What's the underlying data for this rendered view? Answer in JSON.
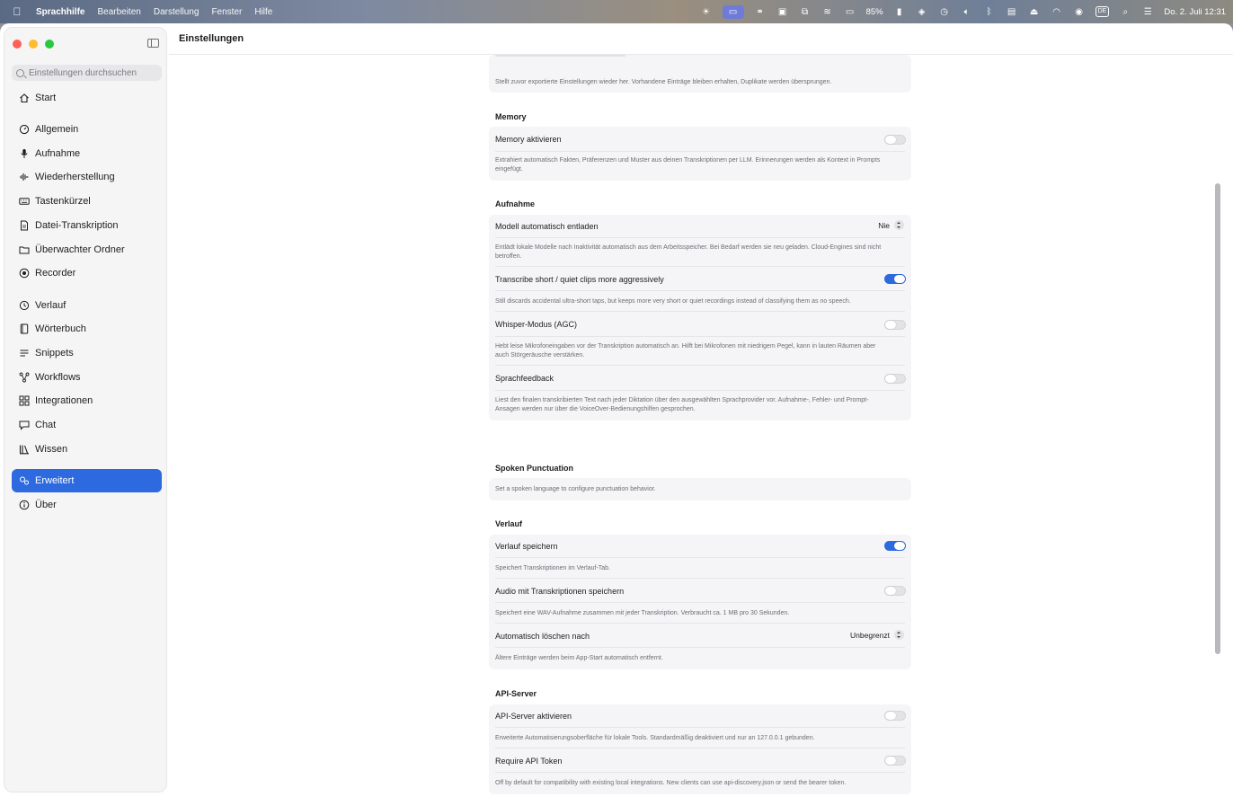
{
  "menubar": {
    "app_name": "Sprachhilfe",
    "menus": [
      "Bearbeiten",
      "Darstellung",
      "Fenster",
      "Hilfe"
    ],
    "battery": "85%",
    "language": "DE",
    "datetime": "Do. 2. Juli  12:31"
  },
  "window": {
    "title": "Einstellungen"
  },
  "sidebar": {
    "search_placeholder": "Einstellungen durchsuchen",
    "items": [
      {
        "label": "Start",
        "icon": "house-icon"
      },
      {
        "label": "Allgemein",
        "icon": "gauge-icon"
      },
      {
        "label": "Aufnahme",
        "icon": "microphone-icon"
      },
      {
        "label": "Wiederherstellung",
        "icon": "waveform-icon"
      },
      {
        "label": "Tastenkürzel",
        "icon": "keyboard-icon"
      },
      {
        "label": "Datei-Transkription",
        "icon": "document-icon"
      },
      {
        "label": "Überwachter Ordner",
        "icon": "folder-icon"
      },
      {
        "label": "Recorder",
        "icon": "record-icon"
      },
      {
        "label": "Verlauf",
        "icon": "history-icon"
      },
      {
        "label": "Wörterbuch",
        "icon": "book-icon"
      },
      {
        "label": "Snippets",
        "icon": "snippets-icon"
      },
      {
        "label": "Workflows",
        "icon": "workflow-icon"
      },
      {
        "label": "Integrationen",
        "icon": "integrations-icon"
      },
      {
        "label": "Chat",
        "icon": "chat-icon"
      },
      {
        "label": "Wissen",
        "icon": "library-icon"
      },
      {
        "label": "Erweitert",
        "icon": "gears-icon"
      },
      {
        "label": "Über",
        "icon": "info-icon"
      }
    ],
    "active": "Erweitert"
  },
  "settings": {
    "restore_desc": "Stellt zuvor exportierte Einstellungen wieder her. Vorhandene Einträge bleiben erhalten, Duplikate werden übersprungen.",
    "memory": {
      "title": "Memory",
      "enable_label": "Memory aktivieren",
      "enable_on": false,
      "enable_desc": "Extrahiert automatisch Fakten, Präferenzen und Muster aus deinen Transkriptionen per LLM. Erinnerungen werden als Kontext in Prompts eingefügt."
    },
    "aufnahme": {
      "title": "Aufnahme",
      "unload_label": "Modell automatisch entladen",
      "unload_value": "Nie",
      "unload_desc": "Entlädt lokale Modelle nach Inaktivität automatisch aus dem Arbeitsspeicher. Bei Bedarf werden sie neu geladen. Cloud-Engines sind nicht betroffen.",
      "short_label": "Transcribe short / quiet clips more aggressively",
      "short_on": true,
      "short_desc": "Still discards accidental ultra-short taps, but keeps more very short or quiet recordings instead of classifying them as no speech.",
      "whisper_label": "Whisper-Modus (AGC)",
      "whisper_on": false,
      "whisper_desc": "Hebt leise Mikrofoneingaben vor der Transkription automatisch an. Hilft bei Mikrofonen mit niedrigem Pegel, kann in lauten Räumen aber auch Störgeräusche verstärken.",
      "feedback_label": "Sprachfeedback",
      "feedback_on": false,
      "feedback_desc": "Liest den finalen transkribierten Text nach jeder Diktation über den ausgewählten Sprachprovider vor. Aufnahme-, Fehler- und Prompt-Ansagen werden nur über die VoiceOver-Bedienungshilfen gesprochen."
    },
    "punctuation": {
      "title": "Spoken Punctuation",
      "desc": "Set a spoken language to configure punctuation behavior."
    },
    "verlauf": {
      "title": "Verlauf",
      "save_label": "Verlauf speichern",
      "save_on": true,
      "save_desc": "Speichert Transkriptionen im Verlauf-Tab.",
      "audio_label": "Audio mit Transkriptionen speichern",
      "audio_on": false,
      "audio_desc": "Speichert eine WAV-Aufnahme zusammen mit jeder Transkription. Verbraucht ca. 1 MB pro 30 Sekunden.",
      "delete_label": "Automatisch löschen nach",
      "delete_value": "Unbegrenzt",
      "delete_desc": "Ältere Einträge werden beim App-Start automatisch entfernt."
    },
    "api": {
      "title": "API-Server",
      "enable_label": "API-Server aktivieren",
      "enable_on": false,
      "enable_desc": "Erweiterte Automatisierungsoberfläche für lokale Tools. Standardmäßig deaktiviert und nur an 127.0.0.1 gebunden.",
      "token_label": "Require API Token",
      "token_on": false,
      "token_desc": "Off by default for compatibility with existing local integrations. New clients can use api-discovery.json or send the bearer token."
    }
  },
  "colors": {
    "accent": "#2d6ae0",
    "sidebar_bg": "#f5f5f6",
    "group_bg": "#f5f5f7"
  }
}
